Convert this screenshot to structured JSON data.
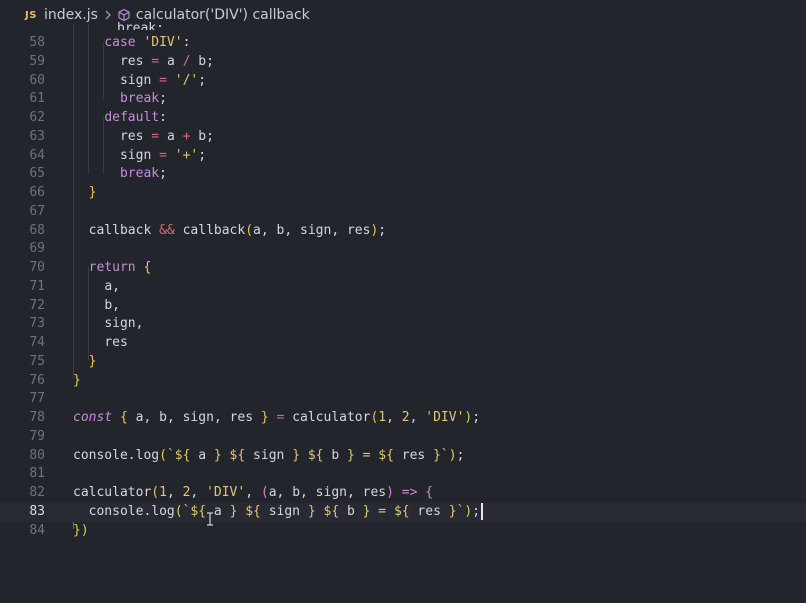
{
  "breadcrumb": {
    "lang_badge": "JS",
    "file": "index.js",
    "symbol": "calculator('DIV') callback",
    "symbol_icon": "cube-icon",
    "separator_icon": "chevron-right-icon"
  },
  "editor": {
    "active_line": 83,
    "lines": [
      {
        "n": "58",
        "text": "    case 'DIV':"
      },
      {
        "n": "59",
        "text": "      res = a / b;"
      },
      {
        "n": "60",
        "text": "      sign = '/';"
      },
      {
        "n": "61",
        "text": "      break;"
      },
      {
        "n": "62",
        "text": "    default:"
      },
      {
        "n": "63",
        "text": "      res = a + b;"
      },
      {
        "n": "64",
        "text": "      sign = '+';"
      },
      {
        "n": "65",
        "text": "      break;"
      },
      {
        "n": "66",
        "text": "  }"
      },
      {
        "n": "67",
        "text": ""
      },
      {
        "n": "68",
        "text": "  callback && callback(a, b, sign, res);"
      },
      {
        "n": "69",
        "text": ""
      },
      {
        "n": "70",
        "text": "  return {"
      },
      {
        "n": "71",
        "text": "    a,"
      },
      {
        "n": "72",
        "text": "    b,"
      },
      {
        "n": "73",
        "text": "    sign,"
      },
      {
        "n": "74",
        "text": "    res"
      },
      {
        "n": "75",
        "text": "  }"
      },
      {
        "n": "76",
        "text": "}"
      },
      {
        "n": "77",
        "text": ""
      },
      {
        "n": "78",
        "text": "const { a, b, sign, res } = calculator(1, 2, 'DIV');"
      },
      {
        "n": "79",
        "text": ""
      },
      {
        "n": "80",
        "text": "console.log(`${ a } ${ sign } ${ b } = ${ res }`);"
      },
      {
        "n": "81",
        "text": ""
      },
      {
        "n": "82",
        "text": "calculator(1, 2, 'DIV', (a, b, sign, res) => {"
      },
      {
        "n": "83",
        "text": "  console.log(`${ a } ${ sign } ${ b } = ${ res }`);"
      },
      {
        "n": "84",
        "text": "})"
      }
    ]
  },
  "colors": {
    "background": "#23252d",
    "keyword": "#c98bd8",
    "string": "#e2c574",
    "operator": "#d46a7e",
    "line_number": "#6e7280"
  }
}
